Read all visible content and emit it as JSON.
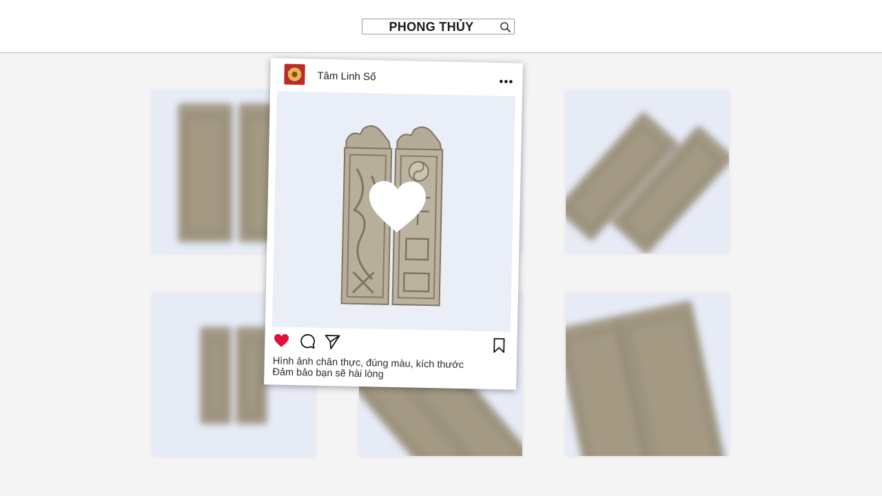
{
  "search": {
    "query": "PHONG THỦY"
  },
  "post": {
    "username": "Tâm Linh Số",
    "caption_line1": "Hình ảnh chân thực, đúng màu, kích thước",
    "caption_line2": "Đảm bảo bạn sẽ hài lòng",
    "liked": true,
    "colors": {
      "like": "#e0123a",
      "avatar_bg": "#c2282a"
    }
  },
  "gallery": {
    "tile_count": 6,
    "tiles": [
      {
        "name": "top-left"
      },
      {
        "name": "top-middle"
      },
      {
        "name": "top-right"
      },
      {
        "name": "bottom-left"
      },
      {
        "name": "bottom-middle"
      },
      {
        "name": "bottom-right"
      }
    ]
  }
}
